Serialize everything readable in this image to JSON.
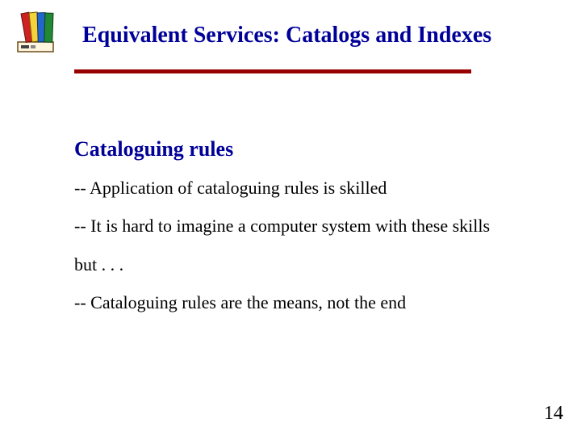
{
  "slide": {
    "title": "Equivalent Services: Catalogs and Indexes",
    "icon": "books-on-shelf-icon",
    "section_heading": "Cataloguing rules",
    "lines": {
      "l0": "--  Application of cataloguing rules is skilled",
      "l1": "--  It is hard to imagine a computer system with these skills",
      "l2": "but . . .",
      "l3": "-- Cataloguing rules are the means, not the end"
    },
    "page_number": "14"
  }
}
